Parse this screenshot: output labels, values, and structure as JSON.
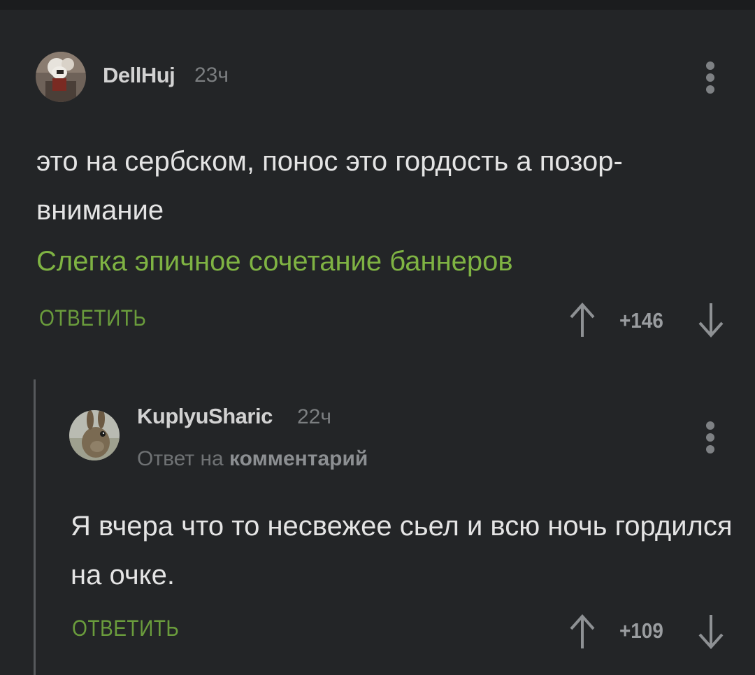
{
  "comments": [
    {
      "author": "DellHuj",
      "time": "23ч",
      "text": "это на сербском, понос это гордость а позор-внимание",
      "link_text": "Слегка эпичное сочетание баннеров",
      "reply_label": "ОТВЕТИТЬ",
      "score": "+146"
    },
    {
      "author": "KuplyuSharic",
      "time": "22ч",
      "reply_to_prefix": "Ответ на",
      "reply_to_link": "комментарий",
      "text": "Я вчера что то несвежее сьел и всю ночь гордился на очке.",
      "reply_label": "ОТВЕТИТЬ",
      "score": "+109"
    }
  ],
  "colors": {
    "background": "#232527",
    "accent_green": "#7fb343",
    "reply_green": "#6a9c3c"
  },
  "icons": [
    "avatar-image",
    "more-vertical-icon",
    "arrow-up-icon",
    "arrow-down-icon"
  ]
}
